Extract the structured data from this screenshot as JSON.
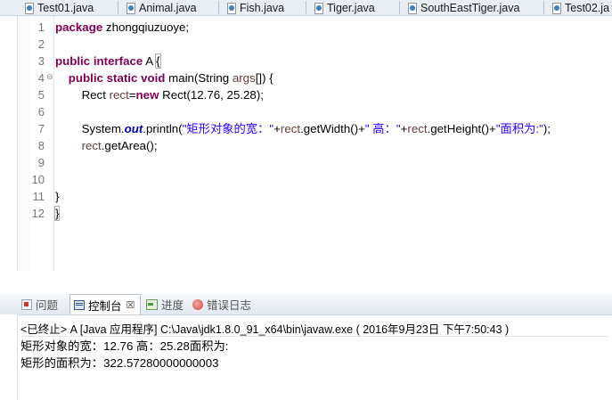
{
  "editor_tabs": [
    {
      "label": "Test01.java"
    },
    {
      "label": "Animal.java"
    },
    {
      "label": "Fish.java"
    },
    {
      "label": "Tiger.java"
    },
    {
      "label": "SouthEastTiger.java"
    },
    {
      "label": "Test02.ja"
    }
  ],
  "code": {
    "line_numbers": [
      "1",
      "2",
      "3",
      "4",
      "5",
      "6",
      "7",
      "8",
      "9",
      "10",
      "11",
      "12"
    ],
    "l1_kw": "package",
    "l1_rest": " zhongqiuzuoye;",
    "l3_kw1": "public",
    "l3_kw2": "interface",
    "l3_name": " A ",
    "l3_brace": "{",
    "l4_indent": "    ",
    "l4_kw1": "public",
    "l4_kw2": "static",
    "l4_kw3": "void",
    "l4_sig": " main(String ",
    "l4_param": "args",
    "l4_end": "[]) {",
    "l5_indent": "        ",
    "l5_type": "Rect ",
    "l5_var": "rect",
    "l5_eq": "=",
    "l5_new": "new",
    "l5_ctor": " Rect(12.76, 25.28);",
    "l7_indent": "        ",
    "l7_sys": "System.",
    "l7_out": "out",
    "l7_call": ".println(",
    "l7_s1": "\"矩形对象的宽：\"",
    "l7_plus1": "+",
    "l7_v1": "rect",
    "l7_m1": ".getWidth()+",
    "l7_s2": "\" 高：\"",
    "l7_plus2": "+",
    "l7_v2": "rect",
    "l7_m2": ".getHeight()+",
    "l7_s3": "\"面积为:\"",
    "l7_end": ");",
    "l8_indent": "        ",
    "l8_var": "rect",
    "l8_call": ".getArea();",
    "l11": "}",
    "l12": "}"
  },
  "console": {
    "tabs": [
      {
        "label": "问题"
      },
      {
        "label": "控制台"
      },
      {
        "label": "进度"
      },
      {
        "label": "错误日志"
      }
    ],
    "close_glyph": "☒",
    "terminated_line": "<已终止> A [Java 应用程序] C:\\Java\\jdk1.8.0_91_x64\\bin\\javaw.exe ( 2016年9月23日 下午7:50:43 )",
    "output": [
      "矩形对象的宽：12.76 高：25.28面积为:",
      "矩形的面积为：322.57280000000003"
    ]
  },
  "colors": {
    "keyword": "#7f0055",
    "string": "#2a00ff",
    "field": "#0000c0",
    "local_var": "#6a3e3e",
    "change_bar": "#c5d5e8"
  }
}
